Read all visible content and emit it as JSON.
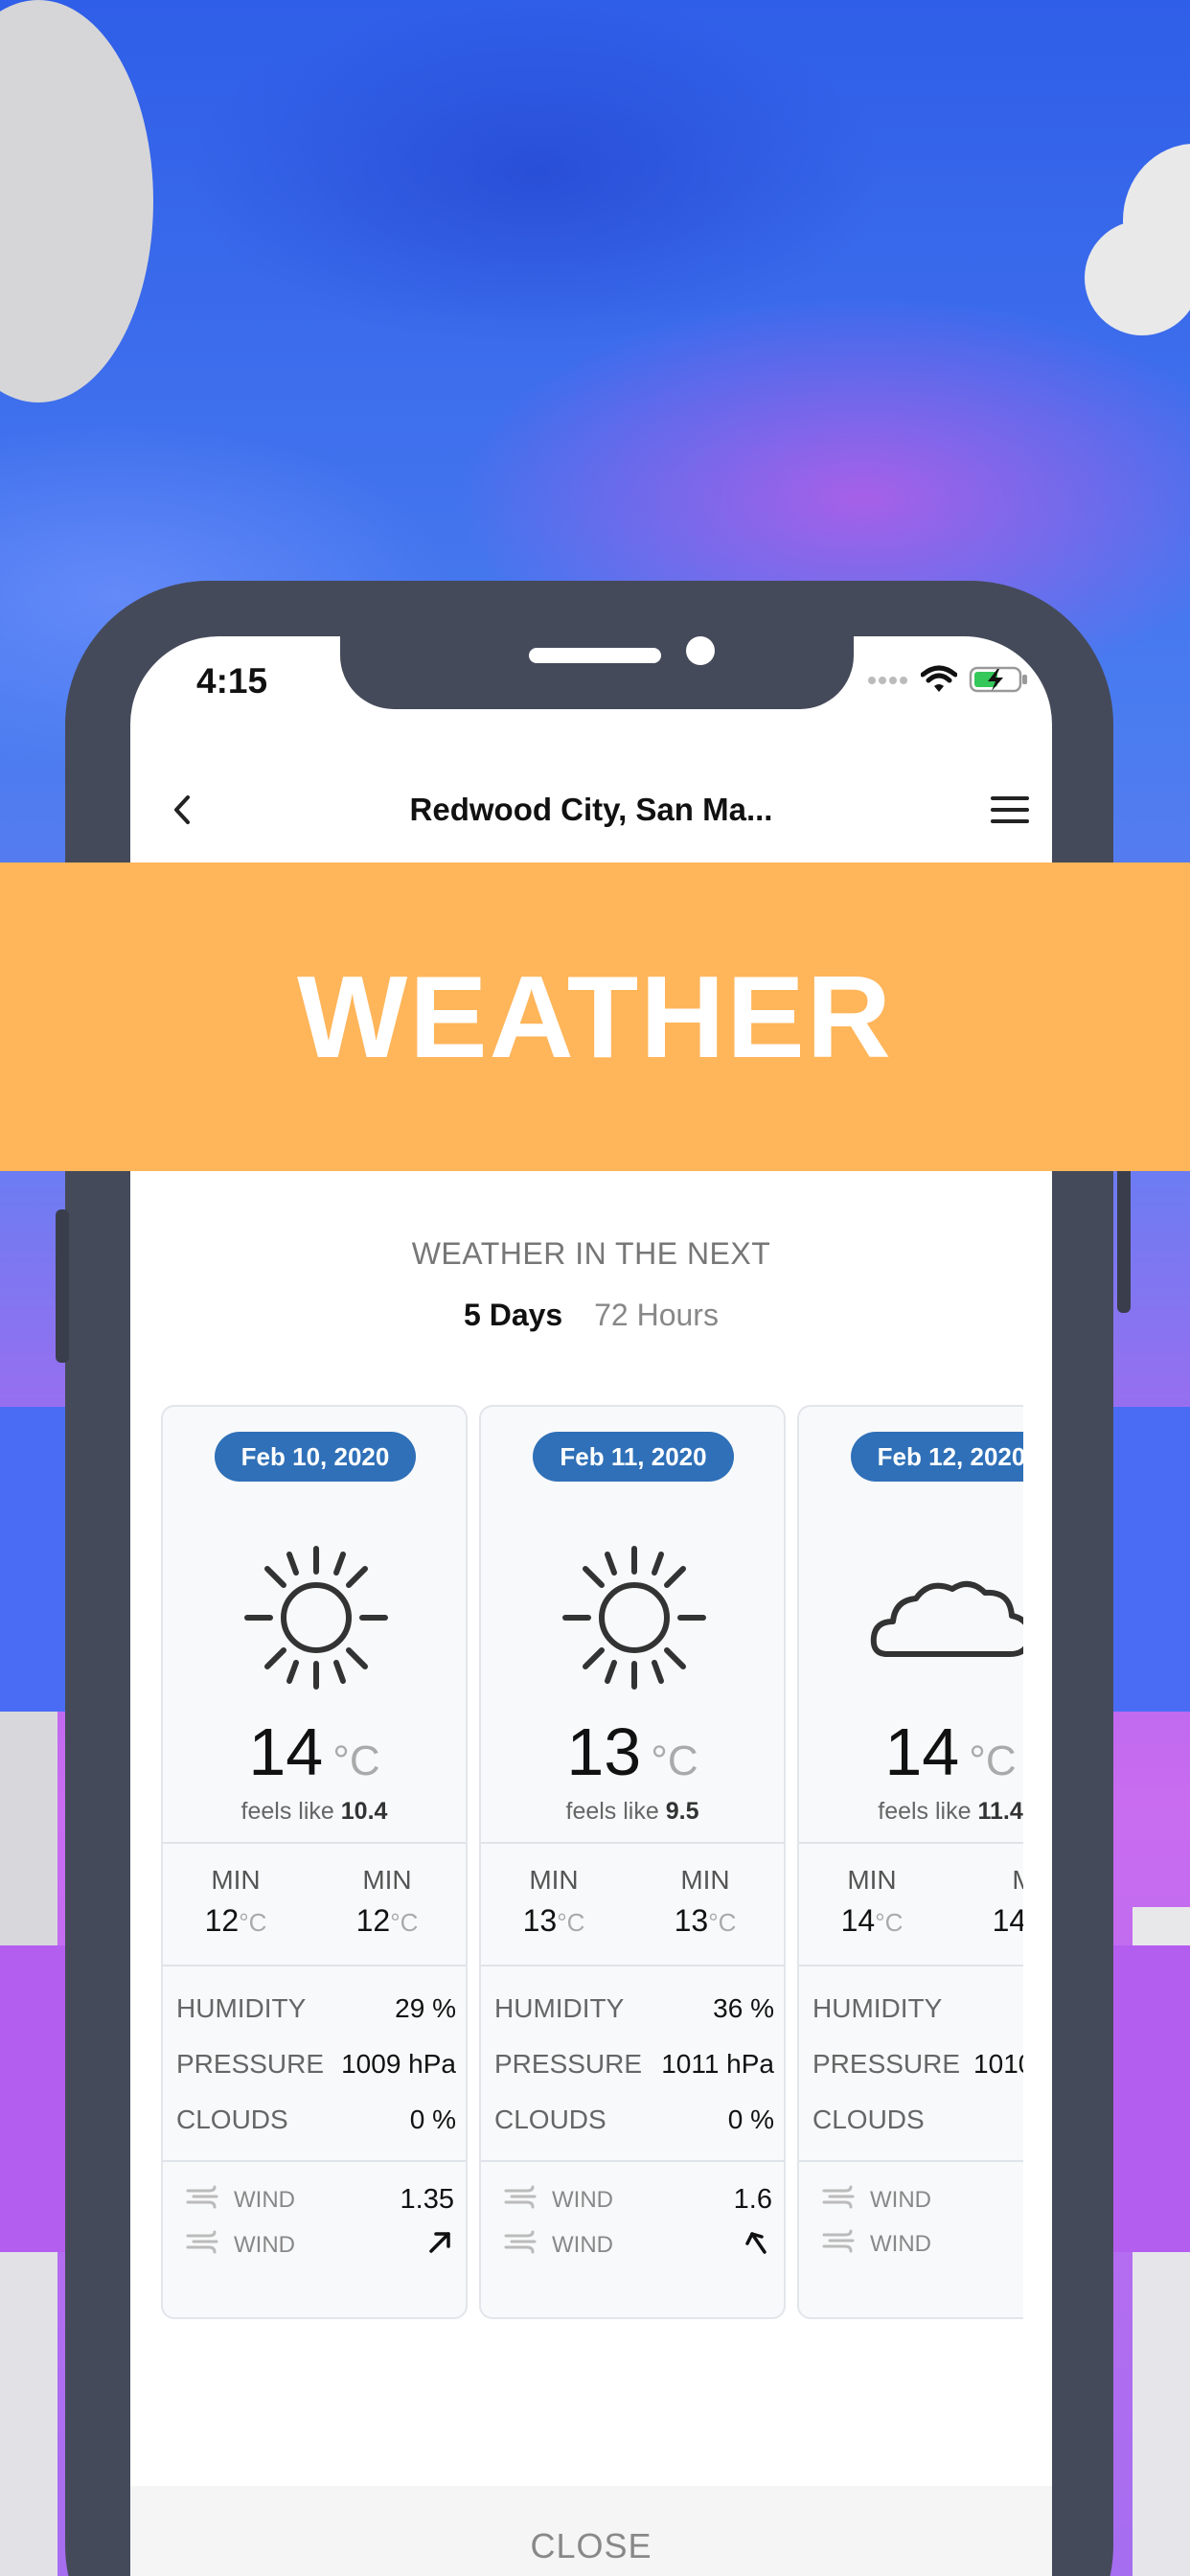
{
  "status_bar": {
    "time": "4:15"
  },
  "header": {
    "title": "Redwood City, San Ma..."
  },
  "banner": {
    "title": "WEATHER"
  },
  "forecast": {
    "heading": "WEATHER IN THE NEXT",
    "tabs": [
      {
        "label": "5 Days",
        "active": true
      },
      {
        "label": "72 Hours",
        "active": false
      }
    ],
    "cards": [
      {
        "date": "Feb 10, 2020",
        "icon": "sun-icon",
        "temp": "14",
        "unit": "°C",
        "feels_label": "feels like",
        "feels_value": "10.4",
        "min_label": "MIN",
        "min_value": "12",
        "max_label": "MIN",
        "max_value": "12",
        "deg": "°C",
        "humidity_label": "HUMIDITY",
        "humidity": "29 %",
        "pressure_label": "PRESSURE",
        "pressure": "1009 hPa",
        "clouds_label": "CLOUDS",
        "clouds": "0 %",
        "wind_label": "WIND",
        "wind_speed": "1.35",
        "wind_dir_label": "WIND",
        "wind_direction": "arrow-up-right-icon"
      },
      {
        "date": "Feb 11, 2020",
        "icon": "sun-icon",
        "temp": "13",
        "unit": "°C",
        "feels_label": "feels like",
        "feels_value": "9.5",
        "min_label": "MIN",
        "min_value": "13",
        "max_label": "MIN",
        "max_value": "13",
        "deg": "°C",
        "humidity_label": "HUMIDITY",
        "humidity": "36 %",
        "pressure_label": "PRESSURE",
        "pressure": "1011 hPa",
        "clouds_label": "CLOUDS",
        "clouds": "0 %",
        "wind_label": "WIND",
        "wind_speed": "1.6",
        "wind_dir_label": "WIND",
        "wind_direction": "arrow-up-left-icon"
      },
      {
        "date": "Feb 12, 2020",
        "icon": "cloud-icon",
        "temp": "14",
        "unit": "°C",
        "feels_label": "feels like",
        "feels_value": "11.4",
        "min_label": "MIN",
        "min_value": "14",
        "max_label": "M",
        "max_value": "14",
        "deg": "°C",
        "humidity_label": "HUMIDITY",
        "humidity": "",
        "pressure_label": "PRESSURE",
        "pressure": "1010",
        "clouds_label": "CLOUDS",
        "clouds": "",
        "wind_label": "WIND",
        "wind_speed": "",
        "wind_dir_label": "WIND",
        "wind_direction": ""
      }
    ]
  },
  "close": {
    "label": "CLOSE"
  },
  "colors": {
    "banner": "#ffb55a",
    "date_pill": "#2f70b8",
    "phone_frame": "#454a5a",
    "battery_charge": "#34c759"
  }
}
